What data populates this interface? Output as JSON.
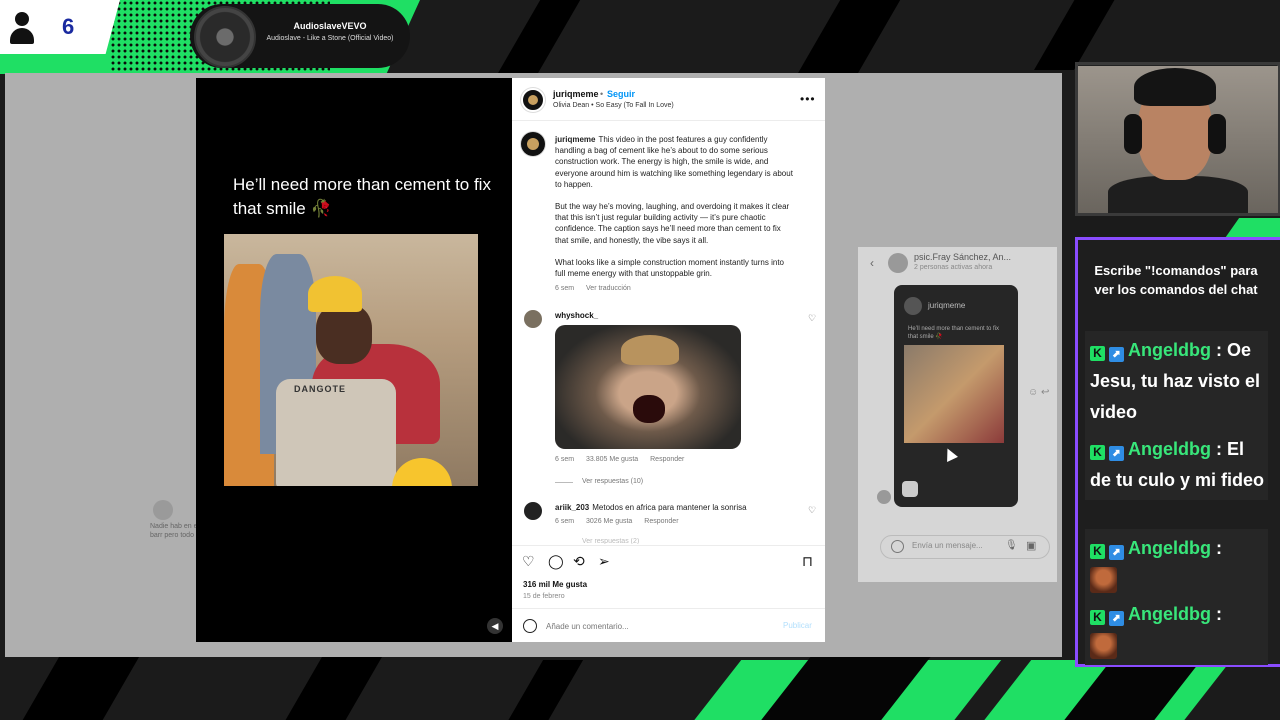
{
  "overlay": {
    "viewer_count": "6",
    "now_playing": {
      "artist": "AudioslaveVEVO",
      "title": "Audioslave - Like a Stone (Official Video)"
    },
    "colors": {
      "accent_green": "#1fdf64",
      "chat_border": "#8a4cff",
      "username": "#38e67a"
    }
  },
  "post": {
    "video_caption": "He’ll need more than cement to fix that smile 🥀",
    "video_bag_text": "DANGOTE",
    "header": {
      "username": "juriqmeme",
      "separator": "•",
      "follow_label": "Seguir",
      "audio": "Olivia Dean • So Easy (To Fall In Love)",
      "more_label": "•••"
    },
    "caption": {
      "username": "juriqmeme",
      "paragraphs": [
        "This video in the post features a guy confidently handling a bag of cement like he’s about to do some serious construction work. The energy is high, the smile is wide, and everyone around him is watching like something legendary is about to happen.",
        "But the way he’s moving, laughing, and overdoing it makes it clear that this isn’t just regular building activity — it’s pure chaotic confidence. The caption says he’ll need more than cement to fix that smile, and honestly, the vibe says it all.",
        "What looks like a simple construction moment instantly turns into full meme energy with that unstoppable grin."
      ],
      "age": "6 sem",
      "translate_label": "Ver traducción"
    },
    "comments": [
      {
        "username": "whyshock_",
        "text": "",
        "age": "6 sem",
        "likes": "33.805 Me gusta",
        "reply_label": "Responder",
        "replies_label": "Ver respuestas (10)"
      },
      {
        "username": "ariik_203",
        "text": "Metodos en africa para mantener la sonrisa",
        "age": "6 sem",
        "likes": "3026 Me gusta",
        "reply_label": "Responder",
        "replies_label": "Ver respuestas (2)"
      }
    ],
    "actions": {
      "like_icon": "heart-icon",
      "comment_icon": "comment-icon",
      "repost_icon": "repost-icon",
      "share_icon": "send-icon",
      "save_icon": "bookmark-icon"
    },
    "likes_total": "316 mil Me gusta",
    "date": "15 de febrero",
    "comment_placeholder": "Añade un comentario...",
    "publish_label": "Publicar"
  },
  "background": {
    "left_comment_user": "mi",
    "left_comment_text": "Nadie hab en el barr pero todo",
    "dm": {
      "back_label": "‹",
      "name": "psic.Fray Sánchez, An...",
      "subtitle": "2 personas activas ahora",
      "card_username": "juriqmeme",
      "card_caption": "He’ll need more than cement to fix that smile 🥀",
      "input_placeholder": "Envía un mensaje..."
    }
  },
  "chat": {
    "header": "Escribe \"!comandos\" para ver los comandos del chat",
    "messages": [
      {
        "badge1": "K",
        "badge2": "⬈",
        "user": "Angeldbg",
        "sep": " :",
        "text": "Oe Jesu, tu haz visto el video"
      },
      {
        "badge1": "K",
        "badge2": "⬈",
        "user": "Angeldbg",
        "sep": " :",
        "text": "El de tu culo y mi fideo"
      },
      {
        "badge1": "K",
        "badge2": "⬈",
        "user": "Angeldbg",
        "sep": " :",
        "text": ""
      },
      {
        "badge1": "K",
        "badge2": "⬈",
        "user": "Angeldbg",
        "sep": " :",
        "text": ""
      }
    ]
  }
}
